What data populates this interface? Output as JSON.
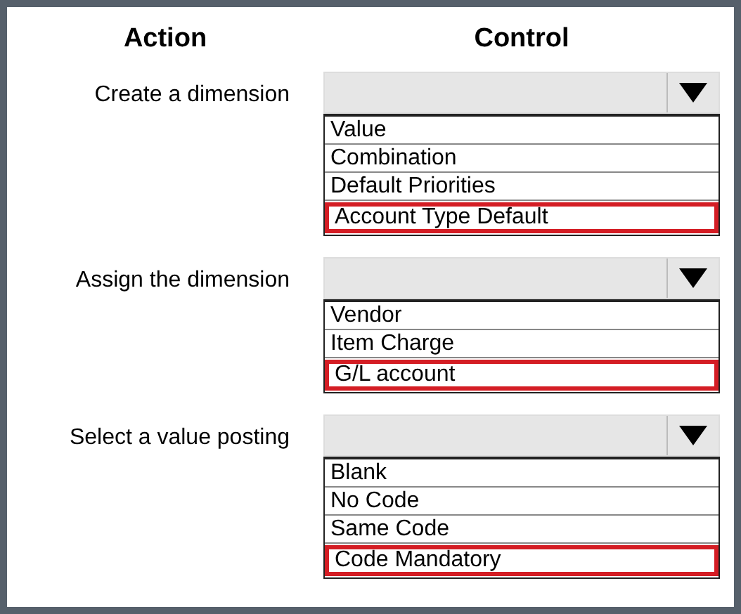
{
  "columns": [
    "Action",
    "Control"
  ],
  "rows": [
    {
      "action": "Create a dimension",
      "options": [
        {
          "label": "Value",
          "selected": false
        },
        {
          "label": "Combination",
          "selected": false
        },
        {
          "label": "Default Priorities",
          "selected": false
        },
        {
          "label": "Account Type Default",
          "selected": true
        }
      ]
    },
    {
      "action": "Assign the dimension",
      "options": [
        {
          "label": "Vendor",
          "selected": false
        },
        {
          "label": "Item Charge",
          "selected": false
        },
        {
          "label": "G/L account",
          "selected": true
        }
      ]
    },
    {
      "action": "Select a value posting",
      "options": [
        {
          "label": "Blank",
          "selected": false
        },
        {
          "label": "No Code",
          "selected": false
        },
        {
          "label": "Same Code",
          "selected": false
        },
        {
          "label": "Code Mandatory",
          "selected": true
        }
      ]
    }
  ]
}
